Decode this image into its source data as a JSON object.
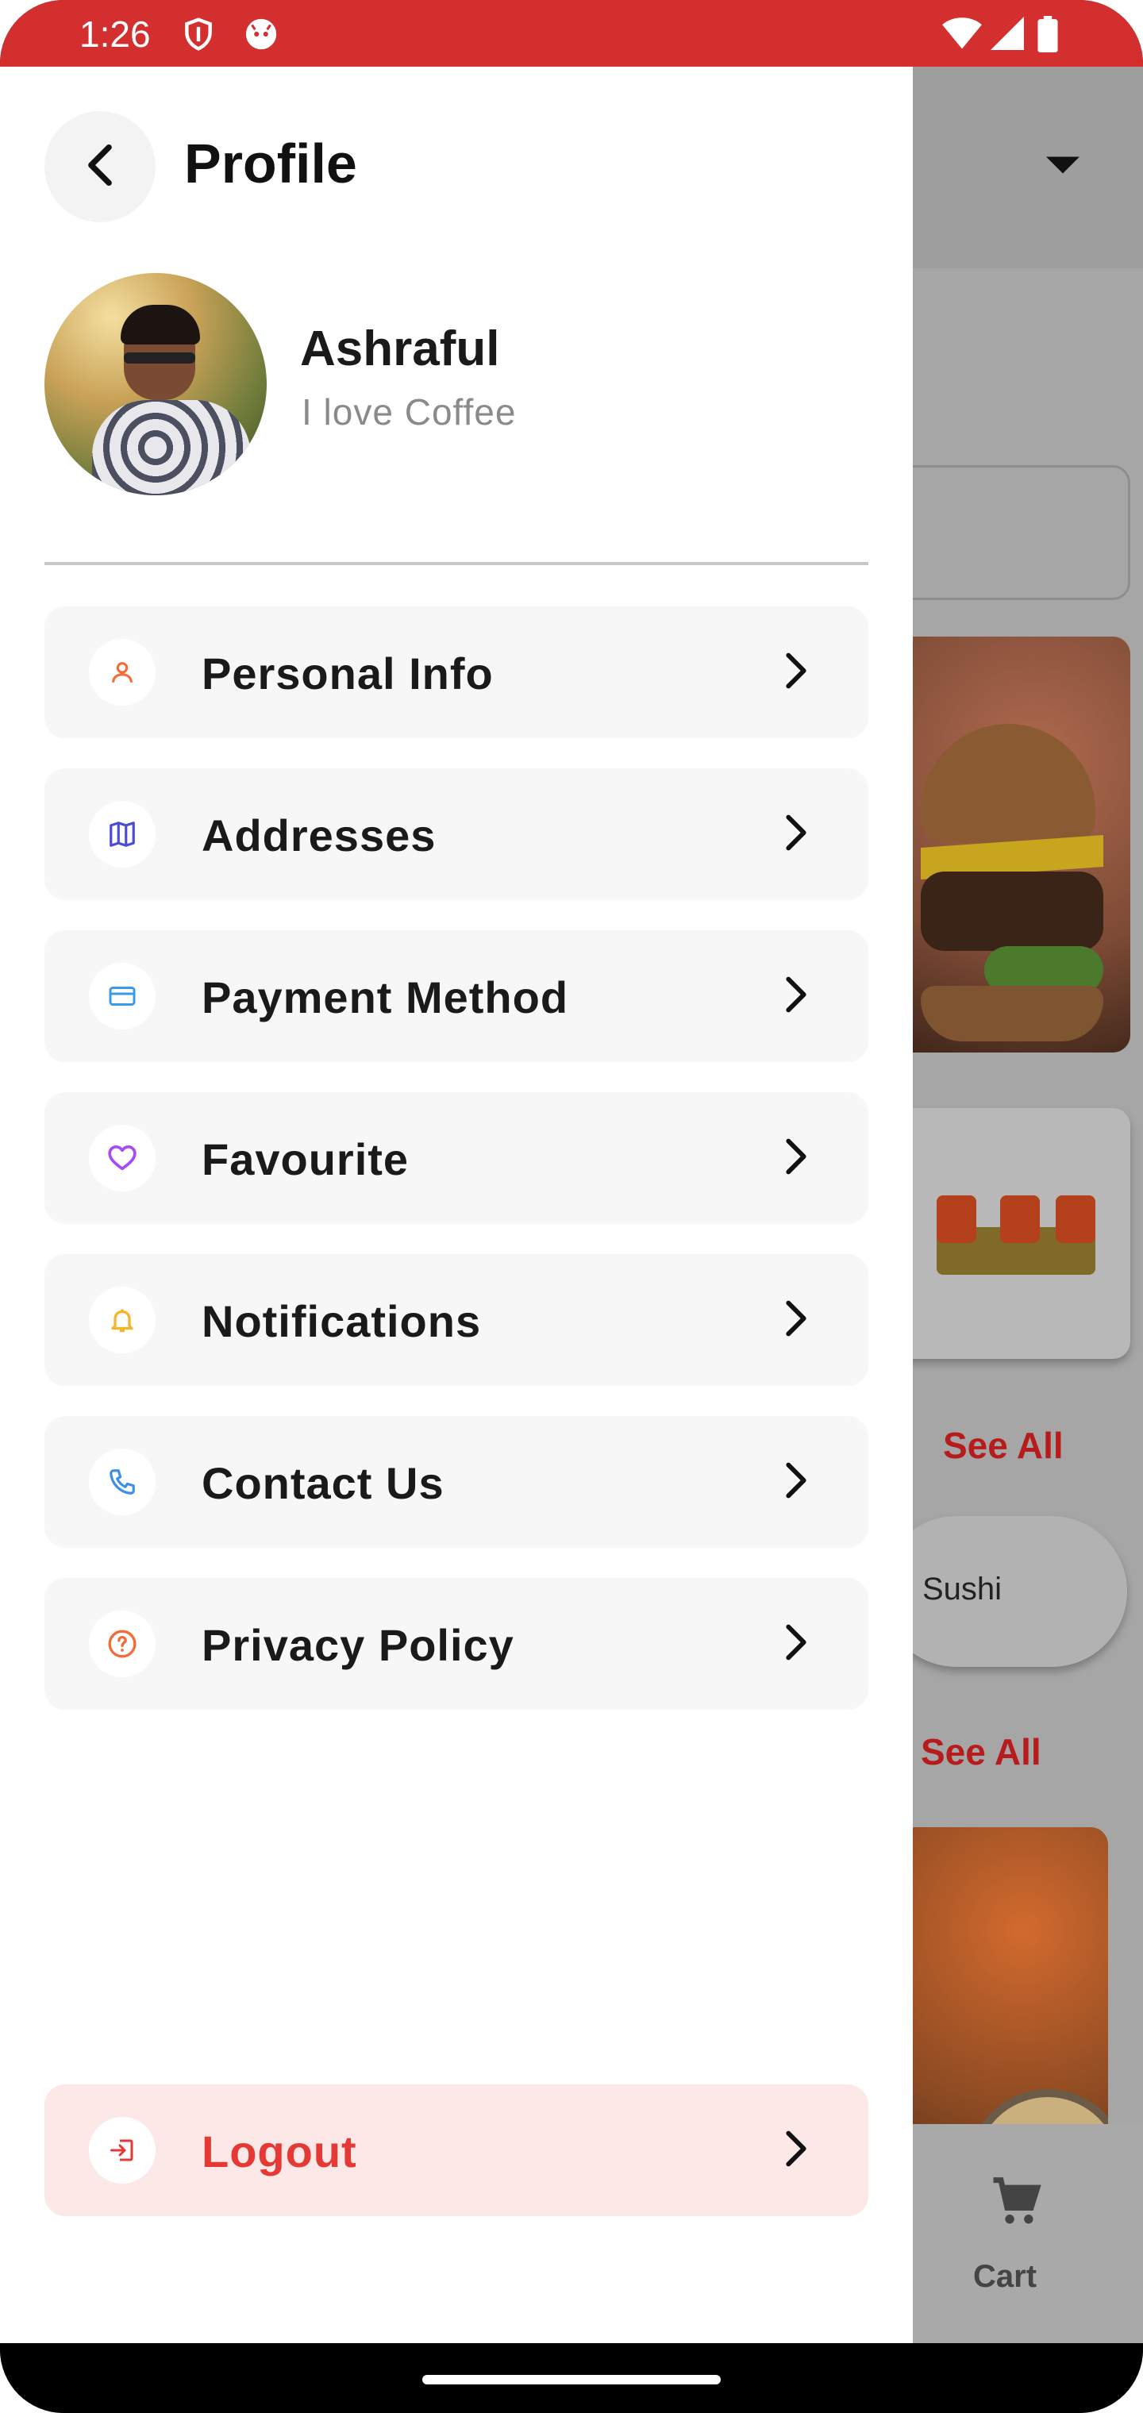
{
  "status_bar": {
    "time": "1:26",
    "background_color": "#d32f2f",
    "icons": [
      "shield-icon",
      "cat-notification-icon",
      "wifi-icon",
      "cell-signal-icon",
      "battery-icon"
    ]
  },
  "drawer": {
    "title": "Profile",
    "back_icon": "chevron-left-icon",
    "user": {
      "name": "Ashraful",
      "bio": "I love Coffee"
    },
    "menu_items": [
      {
        "label": "Personal Info",
        "icon": "person-icon",
        "icon_color": "#f26b3a"
      },
      {
        "label": "Addresses",
        "icon": "map-icon",
        "icon_color": "#4b4bd8"
      },
      {
        "label": "Payment Method",
        "icon": "card-icon",
        "icon_color": "#3b9ae8"
      },
      {
        "label": "Favourite",
        "icon": "heart-icon",
        "icon_color": "#a64bf4"
      },
      {
        "label": "Notifications",
        "icon": "bell-icon",
        "icon_color": "#f5b52a"
      },
      {
        "label": "Contact Us",
        "icon": "phone-icon",
        "icon_color": "#3b8fe8"
      },
      {
        "label": "Privacy Policy",
        "icon": "help-circle-icon",
        "icon_color": "#f26b3a"
      }
    ],
    "logout": {
      "label": "Logout",
      "icon": "logout-icon",
      "color": "#e53935"
    }
  },
  "background_app": {
    "see_all_1": "See All",
    "category_pill": "Sushi",
    "see_all_2": "See All",
    "cart_label": "Cart"
  }
}
